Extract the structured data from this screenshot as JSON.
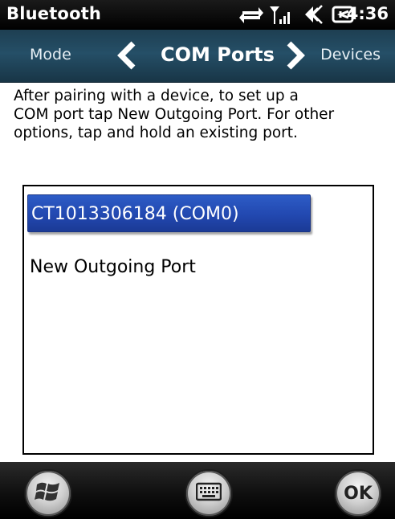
{
  "status_bar": {
    "app_title": "Bluetooth",
    "time": "4:36",
    "icons": [
      "connectivity-icon",
      "signal-icon",
      "volume-icon",
      "battery-charging-icon"
    ]
  },
  "tabs": {
    "previous": "Mode",
    "current": "COM Ports",
    "next": "Devices"
  },
  "description": "After pairing with a device, to set up a COM port tap New Outgoing Port. For other options, tap and hold an existing port.",
  "list": {
    "items": [
      {
        "label": "CT1013306184 (COM0)",
        "selected": true
      },
      {
        "label": "New Outgoing Port",
        "selected": false
      }
    ]
  },
  "bottom_bar": {
    "ok_label": "OK",
    "buttons": [
      "start-icon",
      "keyboard-icon",
      "ok-button"
    ]
  },
  "colors": {
    "selection": "#2248b0",
    "tab_bar": "#254f67",
    "status_bar": "#000000"
  }
}
